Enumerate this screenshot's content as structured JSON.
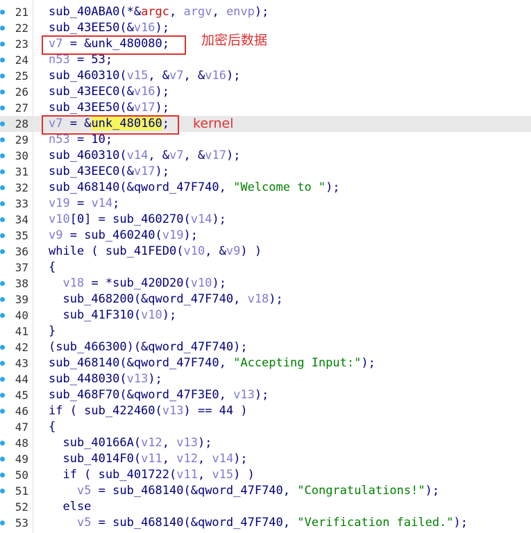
{
  "colors": {
    "keyword": "#000080",
    "variable": "#7b7bd6",
    "string": "#008000",
    "red_identifier": "#cc1010",
    "highlight": "#f5f55e",
    "annotation": "#e03030",
    "breakpoint_dot": "#2aa8e8",
    "current_line": "#e8e8e8"
  },
  "icons": {
    "dot": "breakpoint-dot-icon"
  },
  "annotations": [
    {
      "text": "加密后数据"
    },
    {
      "text": "kernel"
    }
  ],
  "lines": [
    {
      "no": "21",
      "dot": true,
      "segs": [
        [
          "sub_40ABA0(*&",
          ""
        ],
        [
          "argc",
          "t-red"
        ],
        [
          ", ",
          ""
        ],
        [
          "argv",
          "t-var"
        ],
        [
          ", ",
          ""
        ],
        [
          "envp",
          "t-var"
        ],
        [
          ");",
          ""
        ]
      ]
    },
    {
      "no": "22",
      "dot": true,
      "segs": [
        [
          "sub_43EE50(&",
          ""
        ],
        [
          "v16",
          "t-var"
        ],
        [
          ");",
          ""
        ]
      ]
    },
    {
      "no": "23",
      "dot": true,
      "segs": [
        [
          "v7",
          "t-var"
        ],
        [
          " = &unk_480080;",
          ""
        ]
      ]
    },
    {
      "no": "24",
      "dot": true,
      "segs": [
        [
          "n53",
          "t-var"
        ],
        [
          " = 53;",
          ""
        ]
      ]
    },
    {
      "no": "25",
      "dot": true,
      "segs": [
        [
          "sub_460310(",
          ""
        ],
        [
          "v15",
          "t-var"
        ],
        [
          ", &",
          ""
        ],
        [
          "v7",
          "t-var"
        ],
        [
          ", &",
          ""
        ],
        [
          "v16",
          "t-var"
        ],
        [
          ");",
          ""
        ]
      ]
    },
    {
      "no": "26",
      "dot": true,
      "segs": [
        [
          "sub_43EEC0(&",
          ""
        ],
        [
          "v16",
          "t-var"
        ],
        [
          ");",
          ""
        ]
      ]
    },
    {
      "no": "27",
      "dot": true,
      "segs": [
        [
          "sub_43EE50(&",
          ""
        ],
        [
          "v17",
          "t-var"
        ],
        [
          ");",
          ""
        ]
      ]
    },
    {
      "no": "28",
      "dot": true,
      "current": true,
      "segs": [
        [
          "v7",
          "t-var"
        ],
        [
          " = &",
          ""
        ],
        [
          "unk_480160",
          "t-hl"
        ],
        [
          ";",
          ""
        ]
      ]
    },
    {
      "no": "29",
      "dot": true,
      "segs": [
        [
          "n53",
          "t-var"
        ],
        [
          " = 10;",
          ""
        ]
      ]
    },
    {
      "no": "30",
      "dot": true,
      "segs": [
        [
          "sub_460310(",
          ""
        ],
        [
          "v14",
          "t-var"
        ],
        [
          ", &",
          ""
        ],
        [
          "v7",
          "t-var"
        ],
        [
          ", &",
          ""
        ],
        [
          "v17",
          "t-var"
        ],
        [
          ");",
          ""
        ]
      ]
    },
    {
      "no": "31",
      "dot": true,
      "segs": [
        [
          "sub_43EEC0(&",
          ""
        ],
        [
          "v17",
          "t-var"
        ],
        [
          ");",
          ""
        ]
      ]
    },
    {
      "no": "32",
      "dot": true,
      "segs": [
        [
          "sub_468140(&qword_47F740, ",
          ""
        ],
        [
          "\"Welcome to \"",
          "t-str"
        ],
        [
          ");",
          ""
        ]
      ]
    },
    {
      "no": "33",
      "dot": true,
      "segs": [
        [
          "v19",
          "t-var"
        ],
        [
          " = ",
          ""
        ],
        [
          "v14",
          "t-var"
        ],
        [
          ";",
          ""
        ]
      ]
    },
    {
      "no": "34",
      "dot": true,
      "segs": [
        [
          "v10",
          "t-var"
        ],
        [
          "[0] = sub_460270(",
          ""
        ],
        [
          "v14",
          "t-var"
        ],
        [
          ");",
          ""
        ]
      ]
    },
    {
      "no": "35",
      "dot": true,
      "segs": [
        [
          "v9",
          "t-var"
        ],
        [
          " = sub_460240(",
          ""
        ],
        [
          "v19",
          "t-var"
        ],
        [
          ");",
          ""
        ]
      ]
    },
    {
      "no": "36",
      "dot": true,
      "segs": [
        [
          "while ( sub_41FED0(",
          ""
        ],
        [
          "v10",
          "t-var"
        ],
        [
          ", &",
          ""
        ],
        [
          "v9",
          "t-var"
        ],
        [
          ") )",
          ""
        ]
      ]
    },
    {
      "no": "37",
      "dot": false,
      "segs": [
        [
          "{",
          ""
        ]
      ]
    },
    {
      "no": "38",
      "dot": true,
      "segs": [
        [
          "  ",
          ""
        ],
        [
          "v18",
          "t-var"
        ],
        [
          " = *sub_420D20(",
          ""
        ],
        [
          "v10",
          "t-var"
        ],
        [
          ");",
          ""
        ]
      ]
    },
    {
      "no": "39",
      "dot": true,
      "segs": [
        [
          "  sub_468200(&qword_47F740, ",
          ""
        ],
        [
          "v18",
          "t-var"
        ],
        [
          ");",
          ""
        ]
      ]
    },
    {
      "no": "40",
      "dot": true,
      "segs": [
        [
          "  sub_41F310(",
          ""
        ],
        [
          "v10",
          "t-var"
        ],
        [
          ");",
          ""
        ]
      ]
    },
    {
      "no": "41",
      "dot": false,
      "segs": [
        [
          "}",
          ""
        ]
      ]
    },
    {
      "no": "42",
      "dot": true,
      "segs": [
        [
          "(sub_466300)(&qword_47F740);",
          ""
        ]
      ]
    },
    {
      "no": "43",
      "dot": true,
      "segs": [
        [
          "sub_468140(&qword_47F740, ",
          ""
        ],
        [
          "\"Accepting Input:\"",
          "t-str"
        ],
        [
          ");",
          ""
        ]
      ]
    },
    {
      "no": "44",
      "dot": true,
      "segs": [
        [
          "sub_448030(",
          ""
        ],
        [
          "v13",
          "t-var"
        ],
        [
          ");",
          ""
        ]
      ]
    },
    {
      "no": "45",
      "dot": true,
      "segs": [
        [
          "sub_468F70(&qword_47F3E0, ",
          ""
        ],
        [
          "v13",
          "t-var"
        ],
        [
          ");",
          ""
        ]
      ]
    },
    {
      "no": "46",
      "dot": true,
      "segs": [
        [
          "if ( sub_422460(",
          ""
        ],
        [
          "v13",
          "t-var"
        ],
        [
          ") == 44 )",
          ""
        ]
      ]
    },
    {
      "no": "47",
      "dot": false,
      "segs": [
        [
          "{",
          ""
        ]
      ]
    },
    {
      "no": "48",
      "dot": true,
      "segs": [
        [
          "  sub_40166A(",
          ""
        ],
        [
          "v12",
          "t-var"
        ],
        [
          ", ",
          ""
        ],
        [
          "v13",
          "t-var"
        ],
        [
          ");",
          ""
        ]
      ]
    },
    {
      "no": "49",
      "dot": true,
      "segs": [
        [
          "  sub_4014F0(",
          ""
        ],
        [
          "v11",
          "t-var"
        ],
        [
          ", ",
          ""
        ],
        [
          "v12",
          "t-var"
        ],
        [
          ", ",
          ""
        ],
        [
          "v14",
          "t-var"
        ],
        [
          ");",
          ""
        ]
      ]
    },
    {
      "no": "50",
      "dot": true,
      "segs": [
        [
          "  if ( sub_401722(",
          ""
        ],
        [
          "v11",
          "t-var"
        ],
        [
          ", ",
          ""
        ],
        [
          "v15",
          "t-var"
        ],
        [
          ") )",
          ""
        ]
      ]
    },
    {
      "no": "51",
      "dot": true,
      "segs": [
        [
          "    ",
          ""
        ],
        [
          "v5",
          "t-var"
        ],
        [
          " = sub_468140(&qword_47F740, ",
          ""
        ],
        [
          "\"Congratulations!\"",
          "t-str"
        ],
        [
          ");",
          ""
        ]
      ]
    },
    {
      "no": "52",
      "dot": false,
      "segs": [
        [
          "  else",
          ""
        ]
      ]
    },
    {
      "no": "53",
      "dot": true,
      "segs": [
        [
          "    ",
          ""
        ],
        [
          "v5",
          "t-var"
        ],
        [
          " = sub_468140(&qword_47F740, ",
          ""
        ],
        [
          "\"Verification failed.\"",
          "t-str"
        ],
        [
          ");",
          ""
        ]
      ]
    }
  ]
}
